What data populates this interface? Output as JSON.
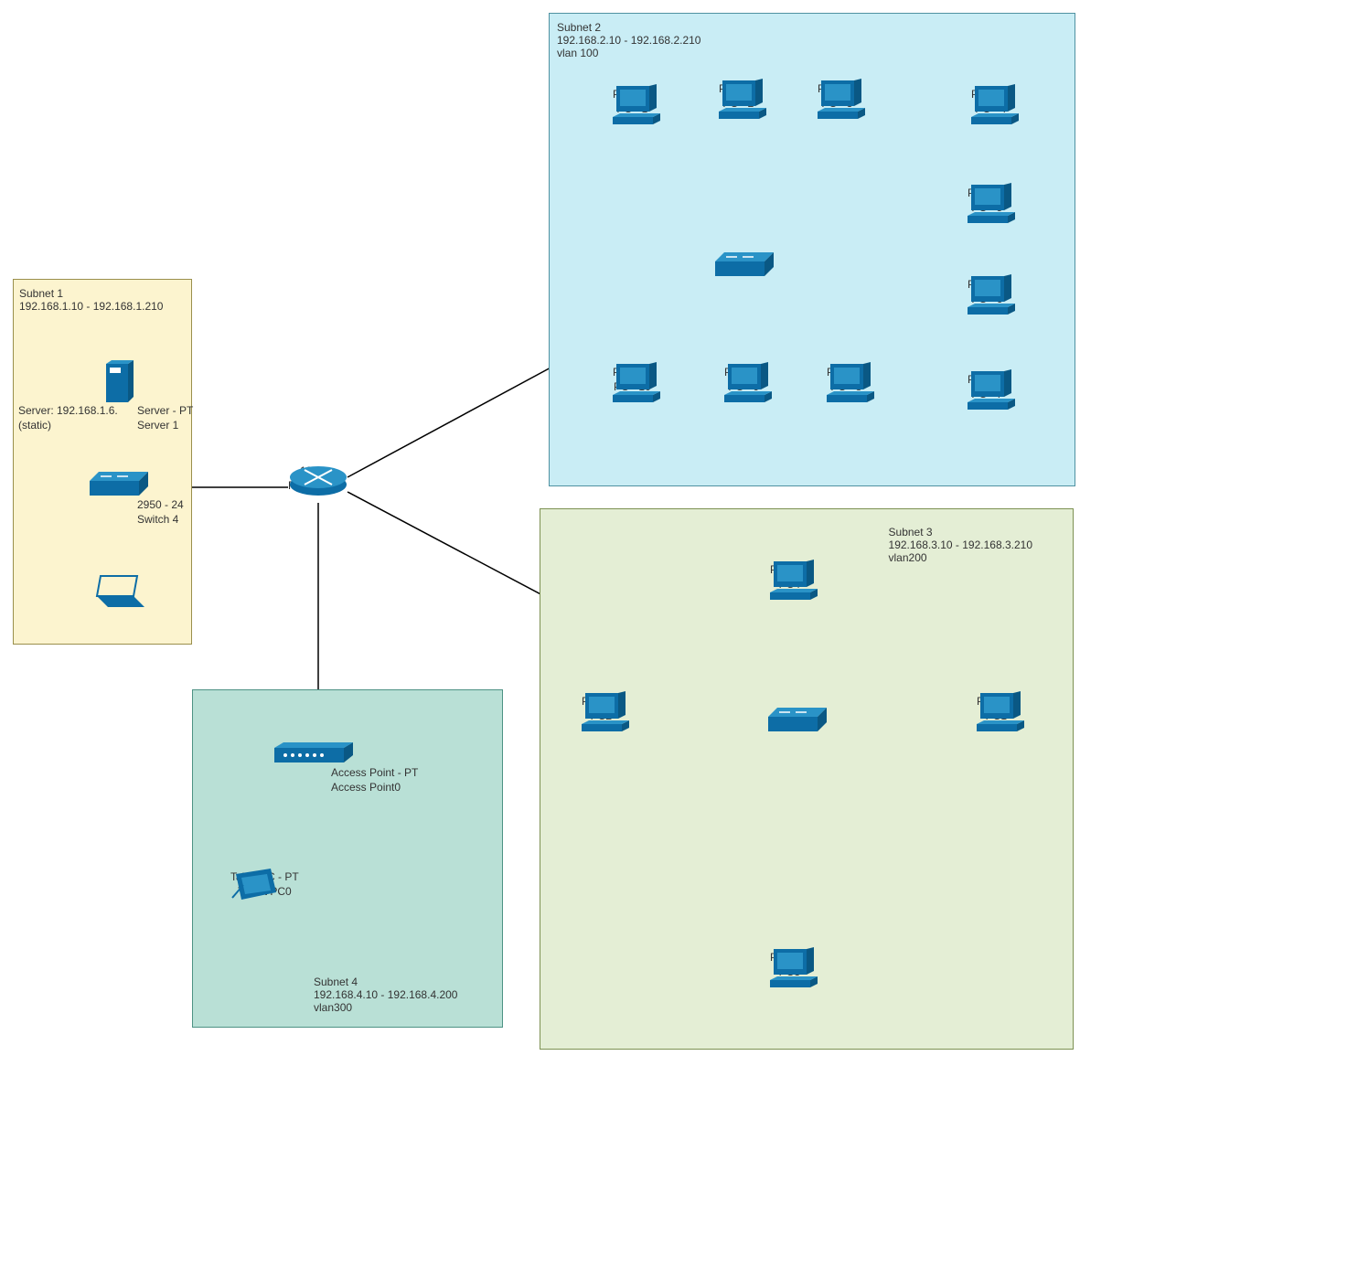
{
  "subnet1": {
    "title": "Subnet 1",
    "range": "192.168.1.10 - 192.168.1.210",
    "server_ip_label": "Server: 192.168.1.6.",
    "server_ip_note": "(static)",
    "server_label1": "Server - PT",
    "server_label2": "Server 1",
    "switch_label1": "2950 - 24",
    "switch_label2": "Switch 4"
  },
  "subnet2": {
    "title": "Subnet 2",
    "range": "192.168.2.10 - 192.168.2.210",
    "vlan": "vlan 100",
    "pcs": [
      {
        "label1": "PC - PT",
        "label2": "PC - 1"
      },
      {
        "label1": "PC - PT",
        "label2": "PC - 2"
      },
      {
        "label1": "PC - PT",
        "label2": "PC - 3"
      },
      {
        "label1": "PC - PT",
        "label2": "PC - 4"
      },
      {
        "label1": "PC - PT",
        "label2": "PC - 5"
      },
      {
        "label1": "PC - PT",
        "label2": "PC - 6"
      },
      {
        "label1": "PC - PT",
        "label2": "PC - 7"
      },
      {
        "label1": "PC - PT",
        "label2": "PC - 8"
      },
      {
        "label1": "PC - PT",
        "label2": "PC - 9"
      },
      {
        "label1": "PC - PT",
        "label2": "PC - 10"
      }
    ]
  },
  "subnet3": {
    "title": "Subnet 3",
    "range": "192.168.3.10 - 192.168.3.210",
    "vlan": "vlan200",
    "pcs": [
      {
        "label1": "PC - PT",
        "label2": "PC1"
      },
      {
        "label1": "PC - PT",
        "label2": "PC2"
      },
      {
        "label1": "PC - PT",
        "label2": "PC3"
      },
      {
        "label1": "PC - PT",
        "label2": "PC4"
      }
    ]
  },
  "subnet4": {
    "title": "Subnet 4",
    "range": "192.168.4.10 - 192.168.4.200",
    "vlan": "vlan300",
    "ap_label1": "Access Point - PT",
    "ap_label2": "Access Point0",
    "tablet_label1": "TabletPC - PT",
    "tablet_label2": "Tablet PC0"
  },
  "router": {
    "label1": "1841",
    "label2": "Router 10"
  },
  "colors": {
    "cisco_blue": "#0d6da6",
    "cisco_top": "#1a7fb9"
  }
}
